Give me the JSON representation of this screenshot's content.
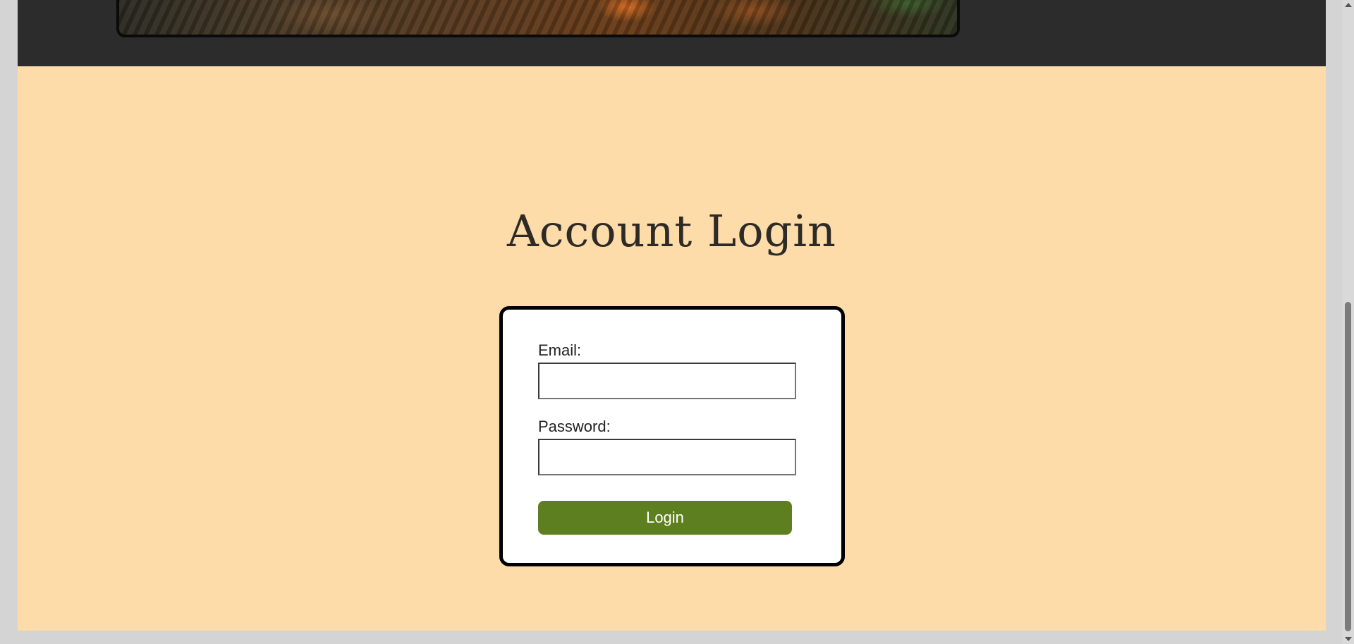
{
  "page": {
    "title": "Account Login"
  },
  "banner": {
    "icon": "landscape-image"
  },
  "login_form": {
    "email_label": "Email:",
    "email_value": "",
    "password_label": "Password:",
    "password_value": "",
    "submit_label": "Login"
  },
  "colors": {
    "background": "#fddcaa",
    "header": "#2c2c2c",
    "button": "#5e7f20",
    "card_border": "#000000"
  }
}
